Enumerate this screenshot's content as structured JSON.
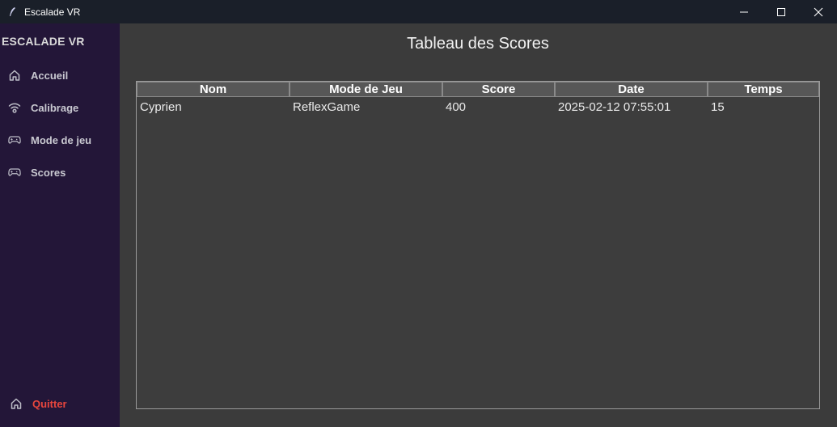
{
  "window": {
    "title": "Escalade VR"
  },
  "sidebar": {
    "brand": "ESCALADE VR",
    "items": [
      {
        "label": "Accueil",
        "icon": "home-icon"
      },
      {
        "label": "Calibrage",
        "icon": "wifi-icon"
      },
      {
        "label": "Mode de jeu",
        "icon": "gamepad-icon"
      },
      {
        "label": "Scores",
        "icon": "gamepad-icon"
      }
    ],
    "quit": {
      "label": "Quitter",
      "icon": "home-icon"
    }
  },
  "main": {
    "title": "Tableau des Scores",
    "table": {
      "columns": [
        "Nom",
        "Mode de Jeu",
        "Score",
        "Date",
        "Temps"
      ],
      "rows": [
        {
          "nom": "Cyprien",
          "mode": "ReflexGame",
          "score": "400",
          "date": "2025-02-12 07:55:01",
          "temps": "15"
        }
      ]
    }
  },
  "colors": {
    "titlebar": "#1a1f29",
    "sidebar": "#231638",
    "main_bg": "#3b3b3b",
    "header_bg": "#575757",
    "quit_accent": "#e8463d"
  }
}
